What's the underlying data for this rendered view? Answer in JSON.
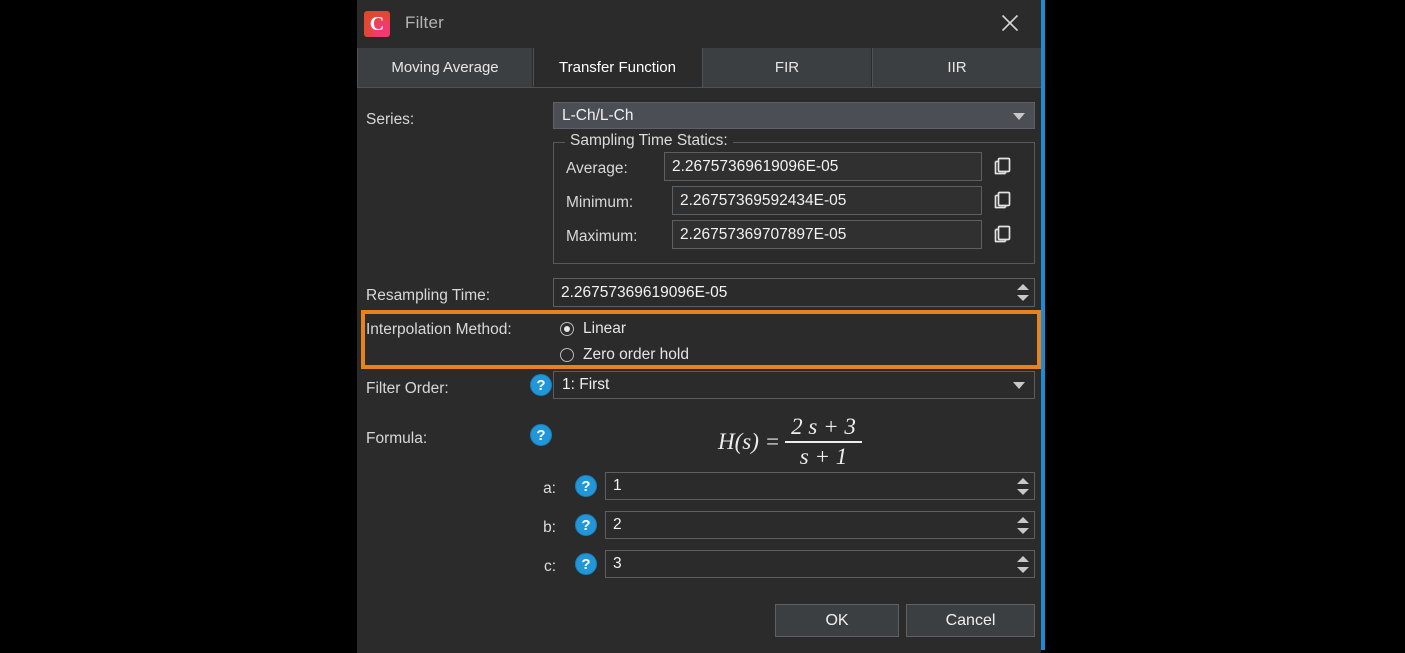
{
  "window": {
    "title": "Filter",
    "app_icon": "camtasia-c-icon",
    "close_icon": "close-icon",
    "accent_color": "#1f8ad2",
    "highlight_color": "#e8821e"
  },
  "tabs": [
    {
      "label": "Moving Average",
      "active": false
    },
    {
      "label": "Transfer Function",
      "active": true
    },
    {
      "label": "FIR",
      "active": false
    },
    {
      "label": "IIR",
      "active": false
    }
  ],
  "series": {
    "label": "Series:",
    "value": "L-Ch/L-Ch",
    "arrow_icon": "chevron-down-icon"
  },
  "sampling_time_statics": {
    "legend": "Sampling Time Statics:",
    "rows": [
      {
        "label": "Average:",
        "value": "2.26757369619096E-05",
        "copy_icon": "copy-icon"
      },
      {
        "label": "Minimum:",
        "value": "2.26757369592434E-05",
        "copy_icon": "copy-icon"
      },
      {
        "label": "Maximum:",
        "value": "2.26757369707897E-05",
        "copy_icon": "copy-icon"
      }
    ]
  },
  "resampling_time": {
    "label": "Resampling Time:",
    "value": "2.26757369619096E-05",
    "spinner_up_icon": "spinner-up-icon",
    "spinner_down_icon": "spinner-down-icon"
  },
  "interpolation_method": {
    "label": "Interpolation Method:",
    "options": [
      {
        "label": "Linear",
        "selected": true
      },
      {
        "label": "Zero order hold",
        "selected": false
      }
    ]
  },
  "filter_order": {
    "label": "Filter Order:",
    "help_icon": "help-icon",
    "value": "1: First",
    "arrow_icon": "chevron-down-icon"
  },
  "formula": {
    "label": "Formula:",
    "help_icon": "help-icon",
    "lhs": "H(s) =",
    "numerator": "2 s + 3",
    "denominator": "s + 1"
  },
  "coefficients": [
    {
      "label": "a:",
      "help_icon": "help-icon",
      "value": "1"
    },
    {
      "label": "b:",
      "help_icon": "help-icon",
      "value": "2"
    },
    {
      "label": "c:",
      "help_icon": "help-icon",
      "value": "3"
    }
  ],
  "buttons": {
    "ok": "OK",
    "cancel": "Cancel"
  }
}
